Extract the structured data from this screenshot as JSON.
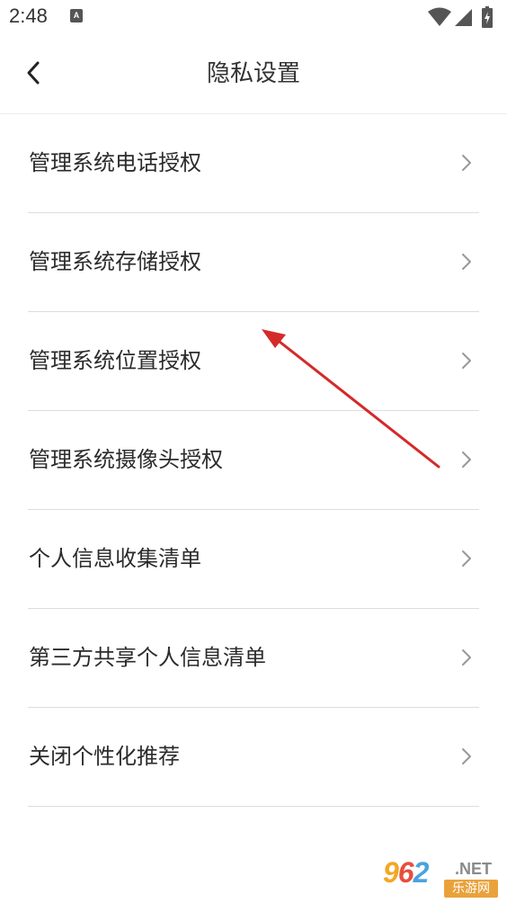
{
  "status_bar": {
    "time": "2:48",
    "notification_icon": "A",
    "icons": [
      "wifi-icon",
      "signal-icon",
      "battery-charging-icon"
    ]
  },
  "header": {
    "back_icon": "chevron-left-icon",
    "title": "隐私设置"
  },
  "menu": {
    "items": [
      {
        "label": "管理系统电话授权",
        "icon": "chevron-right-icon"
      },
      {
        "label": "管理系统存储授权",
        "icon": "chevron-right-icon"
      },
      {
        "label": "管理系统位置授权",
        "icon": "chevron-right-icon"
      },
      {
        "label": "管理系统摄像头授权",
        "icon": "chevron-right-icon"
      },
      {
        "label": "个人信息收集清单",
        "icon": "chevron-right-icon"
      },
      {
        "label": "第三方共享个人信息清单",
        "icon": "chevron-right-icon"
      },
      {
        "label": "关闭个性化推荐",
        "icon": "chevron-right-icon"
      }
    ]
  },
  "annotation": {
    "type": "arrow",
    "color": "#d42a2a"
  },
  "watermark": {
    "digits": [
      "9",
      "6",
      "2"
    ],
    "suffix": ".NET",
    "subtitle": "乐游网"
  },
  "colors": {
    "background": "#ffffff",
    "text": "#2b2b2b",
    "divider": "#dddddd",
    "chevron": "#999999",
    "arrow": "#d42a2a"
  }
}
